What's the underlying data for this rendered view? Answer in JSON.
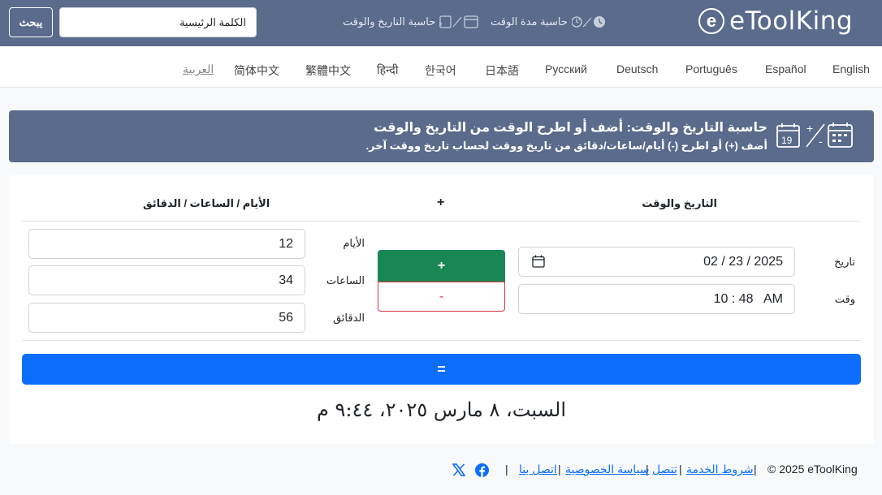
{
  "header": {
    "logo_text": "eToolKing",
    "nav": {
      "duration_label": "حاسبة مدة الوقت",
      "datetime_label": "حاسبة التاريخ والوقت"
    },
    "search": {
      "value": "الكلمة الرئيسية",
      "button_label": "يبحث"
    }
  },
  "languages": [
    {
      "label": "English"
    },
    {
      "label": "Español"
    },
    {
      "label": "Português"
    },
    {
      "label": "Deutsch"
    },
    {
      "label": "Русский"
    },
    {
      "label": "日本語"
    },
    {
      "label": "한국어"
    },
    {
      "label": "हिन्दी"
    },
    {
      "label": "繁體中文"
    },
    {
      "label": "简体中文"
    },
    {
      "label": "العربية",
      "active": true
    }
  ],
  "banner": {
    "title": "حاسبة التاريخ والوقت: أضف أو اطرح الوقت من التاريخ والوقت",
    "subtitle": "أضف (+) أو اطرح (-) أيام/ساعات/دقائق من تاريخ ووقت لحساب تاريخ ووقت آخر."
  },
  "calculator": {
    "col_datetime": "التاريخ والوقت",
    "col_operation": "+",
    "col_units": "الأيام / الساعات / الدقائق",
    "date_label": "تاريخ",
    "date_value": "02 / 23 / 2025",
    "time_label": "وقت",
    "time_value": "10 : 48   AM",
    "plus_label": "+",
    "minus_label": "-",
    "days_label": "الأيام",
    "days_value": "12",
    "hours_label": "الساعات",
    "hours_value": "34",
    "minutes_label": "الدقائق",
    "minutes_value": "56",
    "equals_label": "=",
    "result": "السبت، ٨ مارس ٢٠٢٥، ٩:٤٤ م"
  },
  "footer": {
    "copyright": "© 2025 eToolKing",
    "links": {
      "terms": "شروط الخدمة",
      "connect": "تتصل",
      "privacy": "سياسة الخصوصية",
      "contact": "اتصل بنا"
    },
    "separator": "|"
  },
  "colors": {
    "topbar": "#5a6b8c",
    "plus_button": "#198754",
    "minus_button": "#dc3545",
    "equals_button": "#0d6efd"
  }
}
